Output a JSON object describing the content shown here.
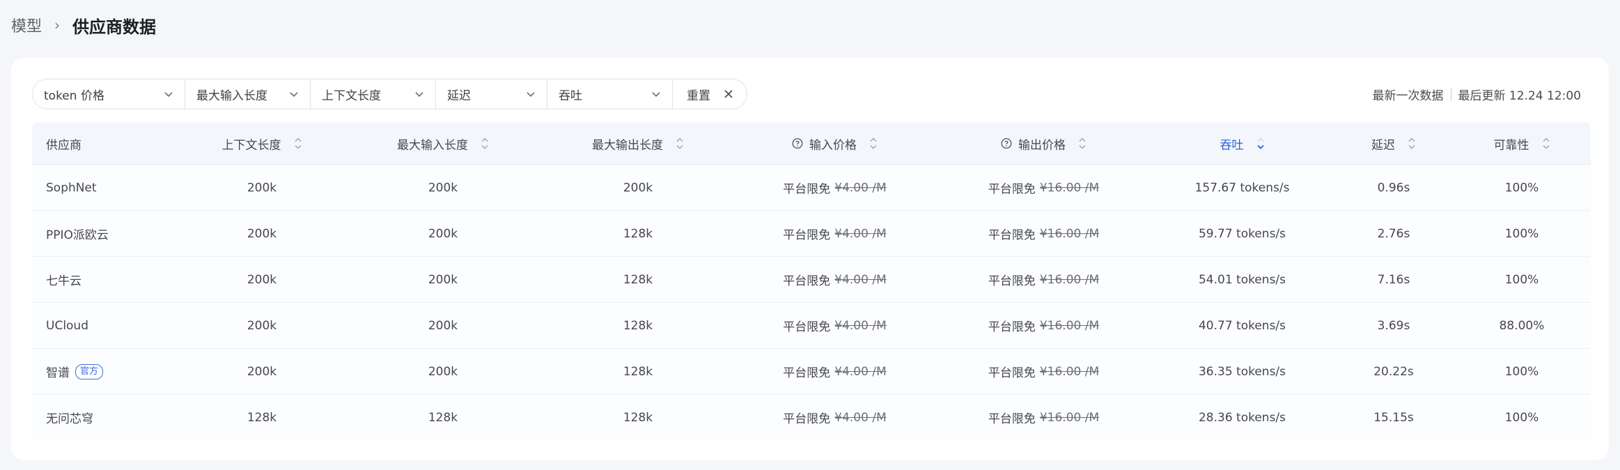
{
  "breadcrumb": {
    "root": "模型",
    "current": "供应商数据"
  },
  "filters": [
    {
      "label": "token 价格"
    },
    {
      "label": "最大输入长度"
    },
    {
      "label": "上下文长度"
    },
    {
      "label": "延迟"
    },
    {
      "label": "吞吐"
    }
  ],
  "reset_label": "重置",
  "update": {
    "latest": "最新一次数据",
    "last_updated": "最后更新 12.24 12:00"
  },
  "columns": {
    "provider": "供应商",
    "context": "上下文长度",
    "max_input": "最大输入长度",
    "max_output": "最大输出长度",
    "input_price": "输入价格",
    "output_price": "输出价格",
    "throughput": "吞吐",
    "latency": "延迟",
    "reliability": "可靠性"
  },
  "free_label": "平台限免",
  "input_price_value": "¥4.00 /M",
  "output_price_value": "¥16.00 /M",
  "rows": [
    {
      "provider": "SophNet",
      "context": "200k",
      "max_input": "200k",
      "max_output": "200k",
      "throughput": "157.67 tokens/s",
      "latency": "0.96s",
      "reliability": "100%"
    },
    {
      "provider": "PPIO派欧云",
      "context": "200k",
      "max_input": "200k",
      "max_output": "128k",
      "throughput": "59.77 tokens/s",
      "latency": "2.76s",
      "reliability": "100%"
    },
    {
      "provider": "七牛云",
      "context": "200k",
      "max_input": "200k",
      "max_output": "128k",
      "throughput": "54.01 tokens/s",
      "latency": "7.16s",
      "reliability": "100%"
    },
    {
      "provider": "UCloud",
      "context": "200k",
      "max_input": "200k",
      "max_output": "128k",
      "throughput": "40.77 tokens/s",
      "latency": "3.69s",
      "reliability": "88.00%"
    },
    {
      "provider": "智谱",
      "badge": "官方",
      "context": "200k",
      "max_input": "200k",
      "max_output": "128k",
      "throughput": "36.35 tokens/s",
      "latency": "20.22s",
      "reliability": "100%"
    },
    {
      "provider": "无问芯穹",
      "context": "128k",
      "max_input": "128k",
      "max_output": "128k",
      "throughput": "28.36 tokens/s",
      "latency": "15.15s",
      "reliability": "100%"
    }
  ],
  "colors": {
    "accent": "#2f5fd8",
    "header_bg": "#f3f7fc",
    "page_bg": "#f5f6f9"
  },
  "icons": {
    "filter_chevron": "chevron-down-icon",
    "reset": "close-icon",
    "sort": "sort-icon",
    "help": "question-circle-icon"
  }
}
